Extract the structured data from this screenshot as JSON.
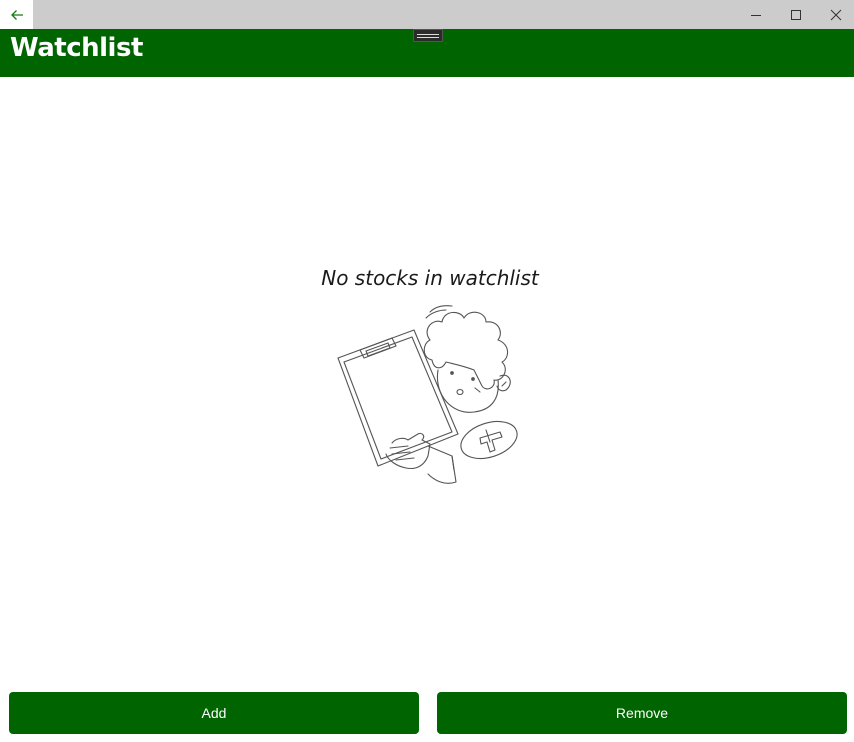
{
  "titlebar": {
    "back_icon": "arrow-left-icon",
    "minimize_icon": "minimize-icon",
    "maximize_icon": "maximize-icon",
    "close_icon": "close-icon",
    "accent_color": "#107c10"
  },
  "header": {
    "title": "Watchlist",
    "background_color": "#006400"
  },
  "main": {
    "empty_message": "No stocks in watchlist",
    "illustration": "person-holding-clipboard-illustration"
  },
  "actions": {
    "add_label": "Add",
    "remove_label": "Remove",
    "button_color": "#006400"
  }
}
